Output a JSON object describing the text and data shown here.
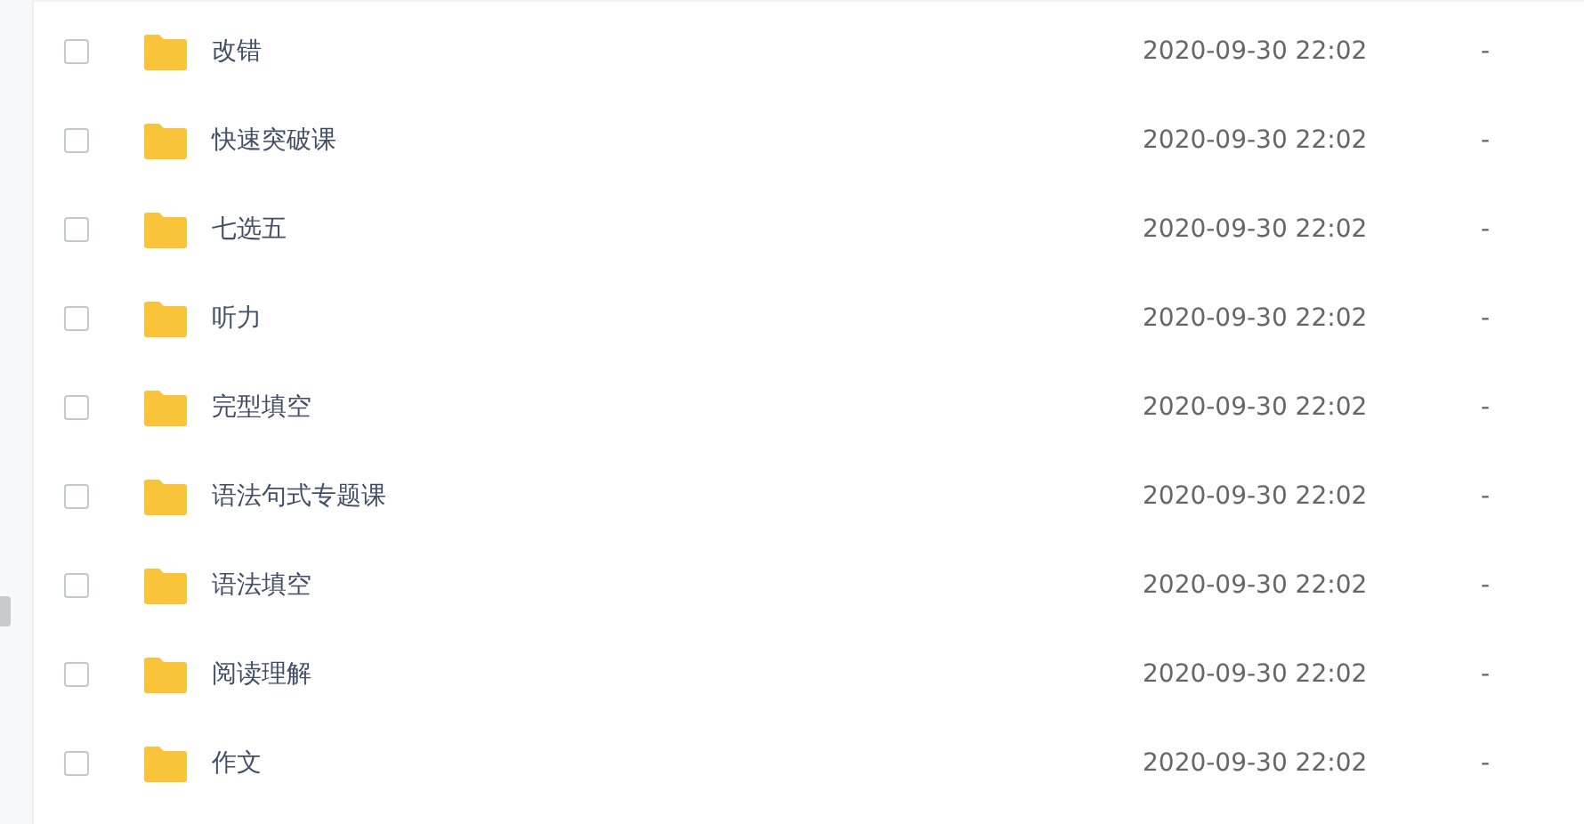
{
  "files": [
    {
      "name": "改错",
      "modified": "2020-09-30 22:02",
      "size": "-",
      "checked": false
    },
    {
      "name": "快速突破课",
      "modified": "2020-09-30 22:02",
      "size": "-",
      "checked": false
    },
    {
      "name": "七选五",
      "modified": "2020-09-30 22:02",
      "size": "-",
      "checked": false
    },
    {
      "name": "听力",
      "modified": "2020-09-30 22:02",
      "size": "-",
      "checked": false
    },
    {
      "name": "完型填空",
      "modified": "2020-09-30 22:02",
      "size": "-",
      "checked": false
    },
    {
      "name": "语法句式专题课",
      "modified": "2020-09-30 22:02",
      "size": "-",
      "checked": false
    },
    {
      "name": "语法填空",
      "modified": "2020-09-30 22:02",
      "size": "-",
      "checked": false
    },
    {
      "name": "阅读理解",
      "modified": "2020-09-30 22:02",
      "size": "-",
      "checked": false
    },
    {
      "name": "作文",
      "modified": "2020-09-30 22:02",
      "size": "-",
      "checked": false
    }
  ]
}
